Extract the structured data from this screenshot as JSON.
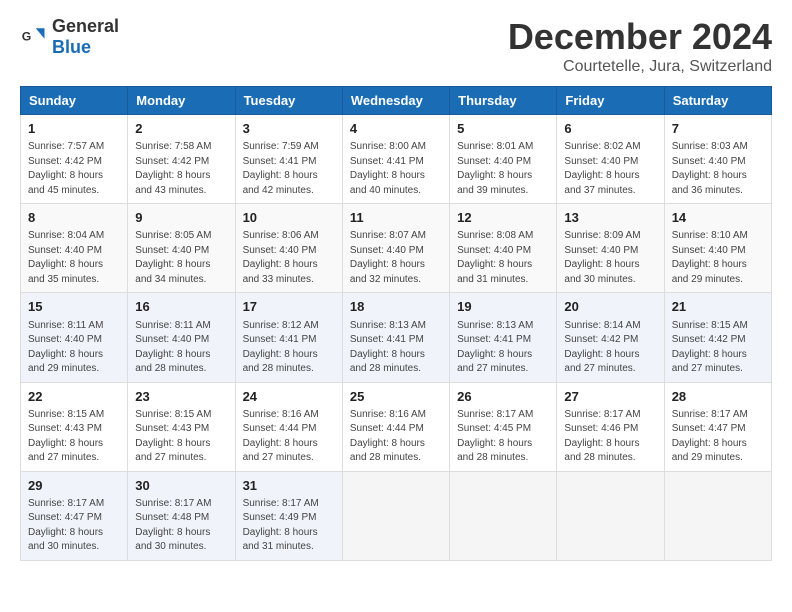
{
  "header": {
    "logo": {
      "general": "General",
      "blue": "Blue"
    },
    "title": "December 2024",
    "location": "Courtetelle, Jura, Switzerland"
  },
  "weekdays": [
    "Sunday",
    "Monday",
    "Tuesday",
    "Wednesday",
    "Thursday",
    "Friday",
    "Saturday"
  ],
  "weeks": [
    [
      {
        "day": "1",
        "sunrise": "7:57 AM",
        "sunset": "4:42 PM",
        "daylight": "8 hours and 45 minutes."
      },
      {
        "day": "2",
        "sunrise": "7:58 AM",
        "sunset": "4:42 PM",
        "daylight": "8 hours and 43 minutes."
      },
      {
        "day": "3",
        "sunrise": "7:59 AM",
        "sunset": "4:41 PM",
        "daylight": "8 hours and 42 minutes."
      },
      {
        "day": "4",
        "sunrise": "8:00 AM",
        "sunset": "4:41 PM",
        "daylight": "8 hours and 40 minutes."
      },
      {
        "day": "5",
        "sunrise": "8:01 AM",
        "sunset": "4:40 PM",
        "daylight": "8 hours and 39 minutes."
      },
      {
        "day": "6",
        "sunrise": "8:02 AM",
        "sunset": "4:40 PM",
        "daylight": "8 hours and 37 minutes."
      },
      {
        "day": "7",
        "sunrise": "8:03 AM",
        "sunset": "4:40 PM",
        "daylight": "8 hours and 36 minutes."
      }
    ],
    [
      {
        "day": "8",
        "sunrise": "8:04 AM",
        "sunset": "4:40 PM",
        "daylight": "8 hours and 35 minutes."
      },
      {
        "day": "9",
        "sunrise": "8:05 AM",
        "sunset": "4:40 PM",
        "daylight": "8 hours and 34 minutes."
      },
      {
        "day": "10",
        "sunrise": "8:06 AM",
        "sunset": "4:40 PM",
        "daylight": "8 hours and 33 minutes."
      },
      {
        "day": "11",
        "sunrise": "8:07 AM",
        "sunset": "4:40 PM",
        "daylight": "8 hours and 32 minutes."
      },
      {
        "day": "12",
        "sunrise": "8:08 AM",
        "sunset": "4:40 PM",
        "daylight": "8 hours and 31 minutes."
      },
      {
        "day": "13",
        "sunrise": "8:09 AM",
        "sunset": "4:40 PM",
        "daylight": "8 hours and 30 minutes."
      },
      {
        "day": "14",
        "sunrise": "8:10 AM",
        "sunset": "4:40 PM",
        "daylight": "8 hours and 29 minutes."
      }
    ],
    [
      {
        "day": "15",
        "sunrise": "8:11 AM",
        "sunset": "4:40 PM",
        "daylight": "8 hours and 29 minutes."
      },
      {
        "day": "16",
        "sunrise": "8:11 AM",
        "sunset": "4:40 PM",
        "daylight": "8 hours and 28 minutes."
      },
      {
        "day": "17",
        "sunrise": "8:12 AM",
        "sunset": "4:41 PM",
        "daylight": "8 hours and 28 minutes."
      },
      {
        "day": "18",
        "sunrise": "8:13 AM",
        "sunset": "4:41 PM",
        "daylight": "8 hours and 28 minutes."
      },
      {
        "day": "19",
        "sunrise": "8:13 AM",
        "sunset": "4:41 PM",
        "daylight": "8 hours and 27 minutes."
      },
      {
        "day": "20",
        "sunrise": "8:14 AM",
        "sunset": "4:42 PM",
        "daylight": "8 hours and 27 minutes."
      },
      {
        "day": "21",
        "sunrise": "8:15 AM",
        "sunset": "4:42 PM",
        "daylight": "8 hours and 27 minutes."
      }
    ],
    [
      {
        "day": "22",
        "sunrise": "8:15 AM",
        "sunset": "4:43 PM",
        "daylight": "8 hours and 27 minutes."
      },
      {
        "day": "23",
        "sunrise": "8:15 AM",
        "sunset": "4:43 PM",
        "daylight": "8 hours and 27 minutes."
      },
      {
        "day": "24",
        "sunrise": "8:16 AM",
        "sunset": "4:44 PM",
        "daylight": "8 hours and 27 minutes."
      },
      {
        "day": "25",
        "sunrise": "8:16 AM",
        "sunset": "4:44 PM",
        "daylight": "8 hours and 28 minutes."
      },
      {
        "day": "26",
        "sunrise": "8:17 AM",
        "sunset": "4:45 PM",
        "daylight": "8 hours and 28 minutes."
      },
      {
        "day": "27",
        "sunrise": "8:17 AM",
        "sunset": "4:46 PM",
        "daylight": "8 hours and 28 minutes."
      },
      {
        "day": "28",
        "sunrise": "8:17 AM",
        "sunset": "4:47 PM",
        "daylight": "8 hours and 29 minutes."
      }
    ],
    [
      {
        "day": "29",
        "sunrise": "8:17 AM",
        "sunset": "4:47 PM",
        "daylight": "8 hours and 30 minutes."
      },
      {
        "day": "30",
        "sunrise": "8:17 AM",
        "sunset": "4:48 PM",
        "daylight": "8 hours and 30 minutes."
      },
      {
        "day": "31",
        "sunrise": "8:17 AM",
        "sunset": "4:49 PM",
        "daylight": "8 hours and 31 minutes."
      },
      null,
      null,
      null,
      null
    ]
  ]
}
